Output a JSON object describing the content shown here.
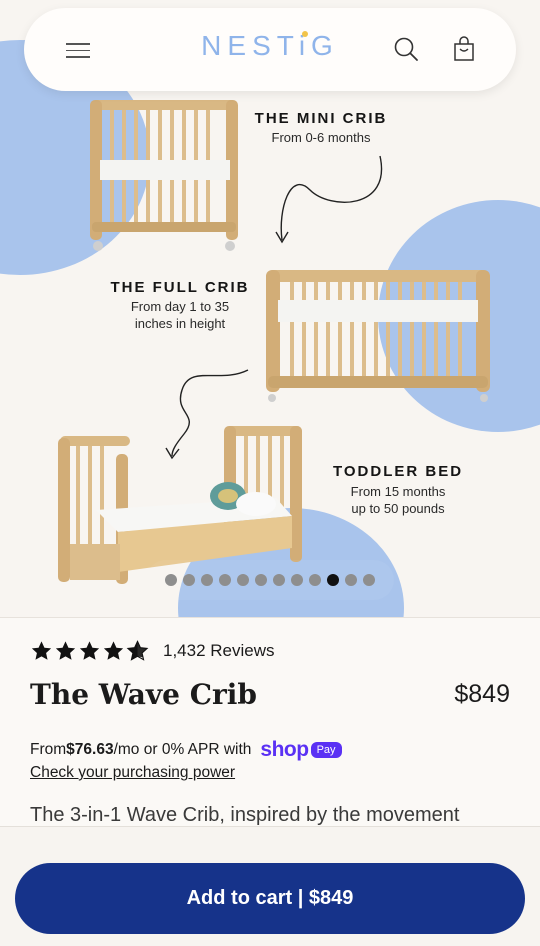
{
  "header": {
    "logo": "NESTiG",
    "menu_icon": "hamburger-menu-icon",
    "search_icon": "search-icon",
    "cart_icon": "shopping-bag-icon"
  },
  "gallery": {
    "stages": [
      {
        "title": "THE MINI CRIB",
        "subtitle": "From 0-6 months"
      },
      {
        "title": "THE FULL CRIB",
        "subtitle_line1": "From day 1 to 35",
        "subtitle_line2": "inches in height"
      },
      {
        "title": "TODDLER BED",
        "subtitle_line1": "From 15 months",
        "subtitle_line2": "up to 50 pounds"
      }
    ],
    "dot_count": 12,
    "active_dot": 9,
    "accent_color": "#a9c4ec"
  },
  "product": {
    "rating": 4.5,
    "reviews": "1,432 Reviews",
    "title": "The Wave Crib",
    "price": "$849",
    "financing_prefix": "From ",
    "financing_amount": "$76.63",
    "financing_suffix": "/mo or 0% APR with",
    "shop_word": "shop",
    "pay_word": "Pay",
    "check_link": "Check your purchasing power",
    "description": "The 3-in-1 Wave Crib, inspired by the movement"
  },
  "cta": {
    "label": "Add to cart | $849",
    "color": "#16338a"
  }
}
